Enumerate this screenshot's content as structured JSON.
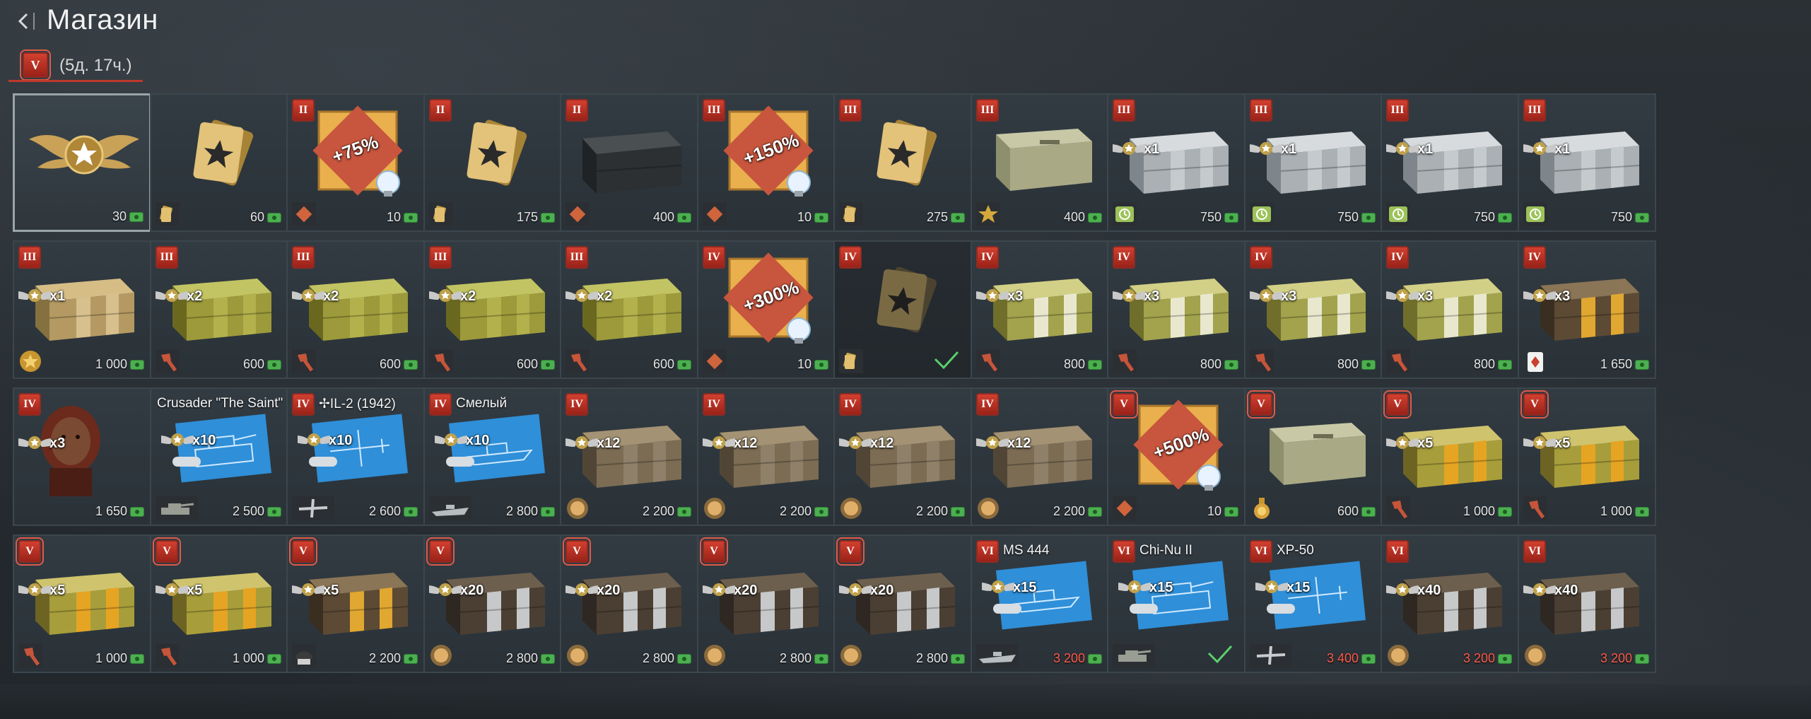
{
  "header": {
    "title": "Магазин",
    "back_icon": "chevron-left-icon"
  },
  "tab": {
    "rank": "V",
    "label": "(5д. 17ч.)"
  },
  "colors": {
    "accent": "#c0392b",
    "currency": "#4caf50",
    "price_unaffordable": "#ff5a4a"
  },
  "items": [
    {
      "row": 0,
      "col": 0,
      "art": "rank-wings",
      "price": "30",
      "selected": true
    },
    {
      "row": 0,
      "col": 1,
      "rank": "",
      "art": "card",
      "price": "60",
      "sub": "cards"
    },
    {
      "row": 0,
      "col": 2,
      "rank": "II",
      "art": "booster",
      "booster": "+75%",
      "price": "10",
      "sub": "diamond"
    },
    {
      "row": 0,
      "col": 3,
      "rank": "II",
      "art": "card",
      "price": "175",
      "sub": "cards"
    },
    {
      "row": 0,
      "col": 4,
      "rank": "II",
      "art": "dark-crate",
      "price": "400",
      "sub": "diamond"
    },
    {
      "row": 0,
      "col": 5,
      "rank": "III",
      "art": "booster",
      "booster": "+150%",
      "price": "10",
      "sub": "diamond"
    },
    {
      "row": 0,
      "col": 6,
      "rank": "III",
      "art": "card",
      "price": "275",
      "sub": "cards"
    },
    {
      "row": 0,
      "col": 7,
      "rank": "III",
      "art": "olive-box",
      "price": "400",
      "sub": "star"
    },
    {
      "row": 0,
      "col": 8,
      "rank": "III",
      "art": "silver-crate",
      "mult": "x1",
      "price": "750",
      "sub": "clock"
    },
    {
      "row": 0,
      "col": 9,
      "rank": "III",
      "art": "silver-crate",
      "mult": "x1",
      "price": "750",
      "sub": "clock"
    },
    {
      "row": 0,
      "col": 10,
      "rank": "III",
      "art": "silver-crate",
      "mult": "x1",
      "price": "750",
      "sub": "clock"
    },
    {
      "row": 0,
      "col": 11,
      "rank": "III",
      "art": "silver-crate",
      "mult": "x1",
      "price": "750",
      "sub": "clock"
    },
    {
      "row": 1,
      "col": 0,
      "rank": "III",
      "art": "tan-crate",
      "mult": "x1",
      "price": "1 000",
      "sub": "gold-star"
    },
    {
      "row": 1,
      "col": 1,
      "rank": "III",
      "art": "olive-crate",
      "mult": "x2",
      "price": "600",
      "sub": "torch"
    },
    {
      "row": 1,
      "col": 2,
      "rank": "III",
      "art": "olive-crate",
      "mult": "x2",
      "price": "600",
      "sub": "torch"
    },
    {
      "row": 1,
      "col": 3,
      "rank": "III",
      "art": "olive-crate",
      "mult": "x2",
      "price": "600",
      "sub": "torch"
    },
    {
      "row": 1,
      "col": 4,
      "rank": "III",
      "art": "olive-crate",
      "mult": "x2",
      "price": "600",
      "sub": "torch"
    },
    {
      "row": 1,
      "col": 5,
      "rank": "IV",
      "art": "booster",
      "booster": "+300%",
      "price": "10",
      "sub": "diamond"
    },
    {
      "row": 1,
      "col": 6,
      "rank": "IV",
      "art": "card-dark",
      "price": "",
      "sub": "cards",
      "owned": true,
      "dim": true
    },
    {
      "row": 1,
      "col": 7,
      "rank": "IV",
      "art": "striped-crate",
      "mult": "x3",
      "price": "800",
      "sub": "torch"
    },
    {
      "row": 1,
      "col": 8,
      "rank": "IV",
      "art": "striped-crate",
      "mult": "x3",
      "price": "800",
      "sub": "torch"
    },
    {
      "row": 1,
      "col": 9,
      "rank": "IV",
      "art": "striped-crate",
      "mult": "x3",
      "price": "800",
      "sub": "torch"
    },
    {
      "row": 1,
      "col": 10,
      "rank": "IV",
      "art": "striped-crate",
      "mult": "x3",
      "price": "800",
      "sub": "torch"
    },
    {
      "row": 1,
      "col": 11,
      "rank": "IV",
      "art": "brown-gold-crate",
      "mult": "x3",
      "price": "1 650",
      "sub": "card-suit"
    },
    {
      "row": 2,
      "col": 0,
      "rank": "IV",
      "art": "portrait",
      "mult": "x3",
      "price": "1 650"
    },
    {
      "row": 2,
      "col": 1,
      "rank": "",
      "caption": "Crusader \"The Saint\"",
      "art": "blueprint",
      "mult": "x10",
      "price": "2 500",
      "sub": "tank"
    },
    {
      "row": 2,
      "col": 2,
      "rank": "IV",
      "caption": "✢IL-2 (1942)",
      "art": "blueprint-plane",
      "mult": "x10",
      "price": "2 600",
      "sub": "plane"
    },
    {
      "row": 2,
      "col": 3,
      "rank": "IV",
      "caption": "Смелый",
      "art": "blueprint-ship",
      "mult": "x10",
      "price": "2 800",
      "sub": "ship"
    },
    {
      "row": 2,
      "col": 4,
      "rank": "IV",
      "art": "wood-crate",
      "mult": "x12",
      "price": "2 200",
      "sub": "medal"
    },
    {
      "row": 2,
      "col": 5,
      "rank": "IV",
      "art": "wood-crate",
      "mult": "x12",
      "price": "2 200",
      "sub": "medal"
    },
    {
      "row": 2,
      "col": 6,
      "rank": "IV",
      "art": "wood-crate",
      "mult": "x12",
      "price": "2 200",
      "sub": "medal"
    },
    {
      "row": 2,
      "col": 7,
      "rank": "IV",
      "art": "wood-crate",
      "mult": "x12",
      "price": "2 200",
      "sub": "medal"
    },
    {
      "row": 2,
      "col": 8,
      "rank": "V",
      "framed": true,
      "art": "booster",
      "booster": "+500%",
      "price": "10",
      "sub": "diamond"
    },
    {
      "row": 2,
      "col": 9,
      "rank": "V",
      "framed": true,
      "art": "olive-box",
      "price": "600",
      "sub": "gold-medal"
    },
    {
      "row": 2,
      "col": 10,
      "rank": "V",
      "framed": true,
      "art": "gold-crate",
      "mult": "x5",
      "price": "1 000",
      "sub": "torch"
    },
    {
      "row": 2,
      "col": 11,
      "rank": "V",
      "framed": true,
      "art": "gold-crate",
      "mult": "x5",
      "price": "1 000",
      "sub": "torch"
    },
    {
      "row": 3,
      "col": 0,
      "rank": "V",
      "framed": true,
      "art": "gold-crate",
      "mult": "x5",
      "price": "1 000",
      "sub": "torch"
    },
    {
      "row": 3,
      "col": 1,
      "rank": "V",
      "framed": true,
      "art": "gold-crate",
      "mult": "x5",
      "price": "1 000",
      "sub": "torch"
    },
    {
      "row": 3,
      "col": 2,
      "rank": "V",
      "framed": true,
      "art": "brown-gold-crate",
      "mult": "x5",
      "price": "2 200",
      "sub": "helmet"
    },
    {
      "row": 3,
      "col": 3,
      "rank": "V",
      "framed": true,
      "art": "dark-wood-crate",
      "mult": "x20",
      "price": "2 800",
      "sub": "medal"
    },
    {
      "row": 3,
      "col": 4,
      "rank": "V",
      "framed": true,
      "art": "dark-wood-crate",
      "mult": "x20",
      "price": "2 800",
      "sub": "medal"
    },
    {
      "row": 3,
      "col": 5,
      "rank": "V",
      "framed": true,
      "art": "dark-wood-crate",
      "mult": "x20",
      "price": "2 800",
      "sub": "medal"
    },
    {
      "row": 3,
      "col": 6,
      "rank": "V",
      "framed": true,
      "art": "dark-wood-crate",
      "mult": "x20",
      "price": "2 800",
      "sub": "medal"
    },
    {
      "row": 3,
      "col": 7,
      "rank": "VI",
      "caption": "MS 444",
      "art": "blueprint-ship",
      "mult": "x15",
      "price": "3 200",
      "red": true,
      "sub": "ship"
    },
    {
      "row": 3,
      "col": 8,
      "rank": "VI",
      "caption": "Chi-Nu II",
      "art": "blueprint",
      "mult": "x15",
      "price": "",
      "owned": true,
      "sub": "tank"
    },
    {
      "row": 3,
      "col": 9,
      "rank": "VI",
      "caption": "XP-50",
      "art": "blueprint-plane",
      "mult": "x15",
      "price": "3 400",
      "red": true,
      "sub": "plane"
    },
    {
      "row": 3,
      "col": 10,
      "rank": "VI",
      "art": "dark-wood-crate",
      "mult": "x40",
      "price": "3 200",
      "red": true,
      "sub": "medal"
    },
    {
      "row": 3,
      "col": 11,
      "rank": "VI",
      "art": "dark-wood-crate",
      "mult": "x40",
      "price": "3 200",
      "red": true,
      "sub": "medal"
    }
  ]
}
